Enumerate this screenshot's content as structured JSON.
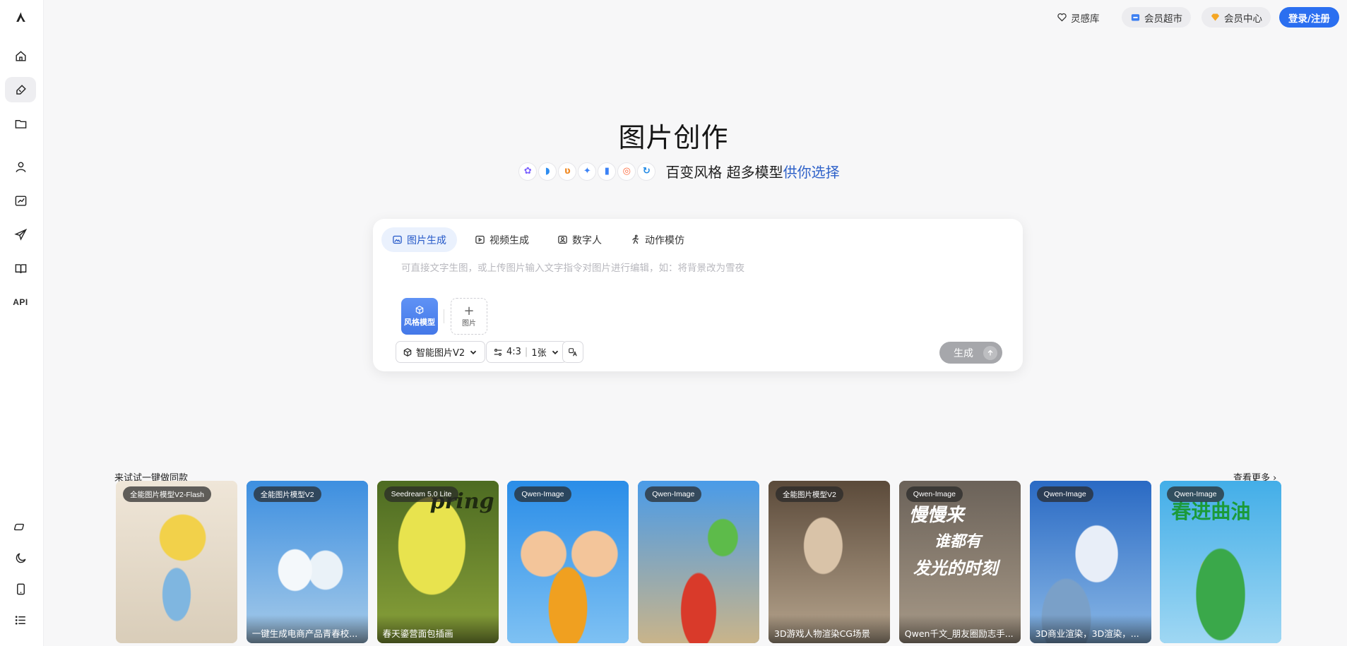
{
  "header": {
    "inspiration": "灵感库",
    "market": "会员超市",
    "member": "会员中心",
    "login": "登录/注册"
  },
  "hero": {
    "title": "图片创作",
    "subtitle_main": "百变风格 超多模型",
    "subtitle_accent": "供你选择"
  },
  "panel": {
    "tabs": [
      {
        "label": "图片生成"
      },
      {
        "label": "视频生成"
      },
      {
        "label": "数字人"
      },
      {
        "label": "动作模仿"
      }
    ],
    "placeholder": "可直接文字生图，或上传图片输入文字指令对图片进行编辑，如：将背景改为雪夜",
    "style_card_label": "风格模型",
    "add_card_label": "图片",
    "model_select": "智能图片V2",
    "ratio_label": "4:3",
    "count_label": "1张",
    "generate_label": "生成"
  },
  "gallery": {
    "title": "来试试一键做同款",
    "more": "查看更多",
    "cards": [
      {
        "tag": "全能图片模型V2-Flash",
        "caption": "",
        "bg": "#e9e0d2"
      },
      {
        "tag": "全能图片模型V2",
        "caption": "一键生成电商产品青春校...",
        "bg": "#3a86d8"
      },
      {
        "tag": "Seedream 5.0 Lite",
        "caption": "春天鎏营面包插画",
        "bg": "#a9b73a"
      },
      {
        "tag": "Qwen-Image",
        "caption": "",
        "bg": "#2e8fe8"
      },
      {
        "tag": "Qwen-Image",
        "caption": "",
        "bg": "#5aa0e0"
      },
      {
        "tag": "全能图片模型V2",
        "caption": "3D游戏人物渲染CG场景",
        "bg": "#8a7660"
      },
      {
        "tag": "Qwen-Image",
        "caption": "Qwen千文_朋友圈励志手...",
        "bg": "#8c7f70"
      },
      {
        "tag": "Qwen-Image",
        "caption": "3D商业渲染，3D渲染，...",
        "bg": "#2f6fc8"
      },
      {
        "tag": "Qwen-Image",
        "caption": "",
        "bg": "#47b0e6"
      }
    ]
  },
  "sidebar": {
    "api_label": "API"
  }
}
